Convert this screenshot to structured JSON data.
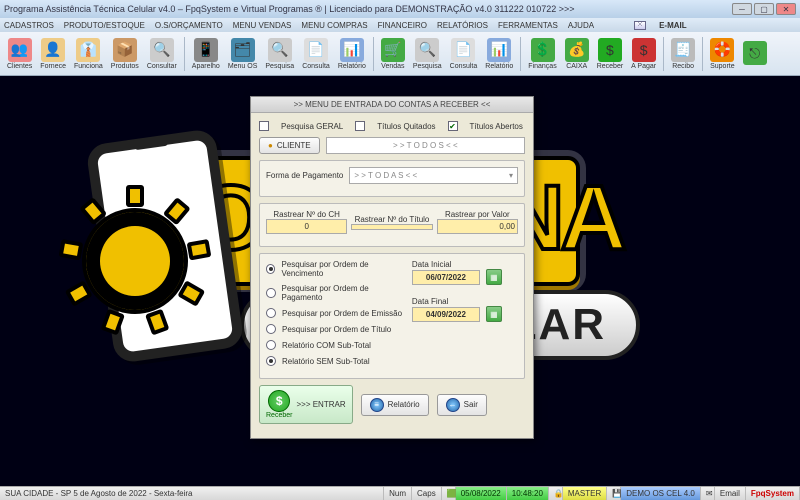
{
  "window": {
    "title": "Programa Assistência Técnica Celular v4.0 – FpqSystem e Virtual Programas ® | Licenciado para  DEMONSTRAÇÃO v4.0 311222 010722 >>>"
  },
  "menu": {
    "items": [
      "CADASTROS",
      "PRODUTO/ESTOQUE",
      "O.S/ORÇAMENTO",
      "MENU VENDAS",
      "MENU COMPRAS",
      "FINANCEIRO",
      "RELATÓRIOS",
      "FERRAMENTAS",
      "AJUDA"
    ],
    "email": "E-MAIL"
  },
  "toolbar": {
    "items": [
      {
        "label": "Clientes",
        "icon": "👥",
        "bg": "#e88"
      },
      {
        "label": "Fornece",
        "icon": "👤",
        "bg": "#ec8"
      },
      {
        "label": "Funciona",
        "icon": "👔",
        "bg": "#ec8"
      },
      {
        "label": "Produtos",
        "icon": "📦",
        "bg": "#c96"
      },
      {
        "label": "Consultar",
        "icon": "🔍",
        "bg": "#ccc"
      },
      {
        "label": "Aparelho",
        "icon": "📱",
        "bg": "#888"
      },
      {
        "label": "Menu OS",
        "icon": "🗂",
        "bg": "#48a"
      },
      {
        "label": "Pesquisa",
        "icon": "🔍",
        "bg": "#ccc"
      },
      {
        "label": "Consulta",
        "icon": "📄",
        "bg": "#ddd"
      },
      {
        "label": "Relatório",
        "icon": "📊",
        "bg": "#8ad"
      },
      {
        "label": "Vendas",
        "icon": "🛒",
        "bg": "#4a4"
      },
      {
        "label": "Pesquisa",
        "icon": "🔍",
        "bg": "#ccc"
      },
      {
        "label": "Consulta",
        "icon": "📄",
        "bg": "#ddd"
      },
      {
        "label": "Relatório",
        "icon": "📊",
        "bg": "#8ad"
      },
      {
        "label": "Finanças",
        "icon": "💲",
        "bg": "#4a4"
      },
      {
        "label": "CAIXA",
        "icon": "💰",
        "bg": "#4a4"
      },
      {
        "label": "Receber",
        "icon": "$",
        "bg": "#2a2"
      },
      {
        "label": "A Pagar",
        "icon": "$",
        "bg": "#c33"
      },
      {
        "label": "Recibo",
        "icon": "🧾",
        "bg": "#bbb"
      },
      {
        "label": "Suporte",
        "icon": "🛟",
        "bg": "#e80"
      },
      {
        "label": "",
        "icon": "⎋",
        "bg": "#4a4"
      }
    ]
  },
  "dialog": {
    "title": ">> MENU DE ENTRADA DO CONTAS A RECEBER <<",
    "chk_geral": "Pesquisa GERAL",
    "chk_quitados": "Títulos Quitados",
    "chk_abertos": "Títulos Abertos",
    "cliente_btn": "CLIENTE",
    "cliente_placeholder": "> > T O D O S < <",
    "forma_label": "Forma de Pagamento",
    "forma_value": "> > T O D A S < <",
    "rastrear_ch": "Rastrear Nº do CH",
    "rastrear_ch_val": "0",
    "rastrear_titulo": "Rastrear Nº do Título",
    "rastrear_titulo_val": "",
    "rastrear_valor": "Rastrear por Valor",
    "rastrear_valor_val": "0,00",
    "radios": [
      "Pesquisar por Ordem de Vencimento",
      "Pesquisar por Ordem de Pagamento",
      "Pesquisar por Ordem de Emissão",
      "Pesquisar por Ordem de Título",
      "Relatório COM Sub-Total",
      "Relatório SEM Sub-Total"
    ],
    "data_inicial_lbl": "Data Inicial",
    "data_inicial": "06/07/2022",
    "data_final_lbl": "Data Final",
    "data_final": "04/09/2022",
    "receber_lbl": "Receber",
    "entrar": ">>> ENTRAR",
    "relatorio": "Relatório",
    "sair": "Sair"
  },
  "logo": {
    "pill_text": "LAR"
  },
  "status": {
    "left": "SUA CIDADE - SP  5 de Agosto de 2022 - Sexta-feira",
    "num": "Num",
    "caps": "Caps",
    "date": "05/08/2022",
    "time": "10:48:20",
    "master": "MASTER",
    "demo": "DEMO OS CEL 4.0",
    "email": "Email",
    "brand": "FpqSystem"
  }
}
